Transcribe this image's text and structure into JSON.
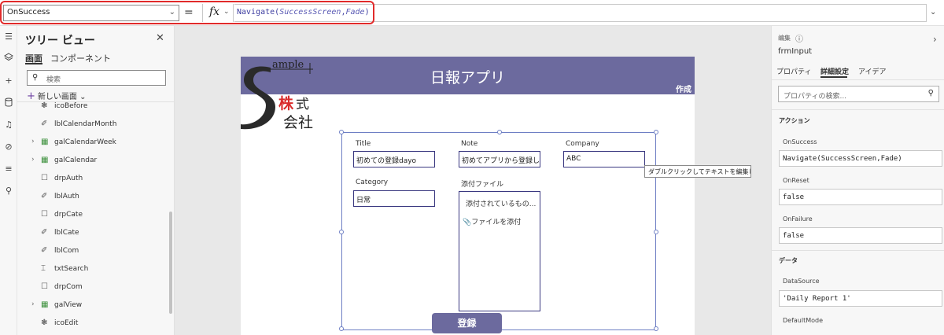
{
  "formula_bar": {
    "property": "OnSuccess",
    "equals": "=",
    "fx": "fx",
    "formula_func": "Navigate(",
    "formula_arg1": "SuccessScreen",
    "formula_sep": ",",
    "formula_arg2": "Fade",
    "formula_close": ")"
  },
  "tree": {
    "title": "ツリー ビュー",
    "tabs": [
      "画面",
      "コンポーネント"
    ],
    "search_placeholder": "検索",
    "new_screen": "新しい画面",
    "items": [
      {
        "label": "icoBefore",
        "icon": "icon-component-icon",
        "expandable": false
      },
      {
        "label": "lblCalendarMonth",
        "icon": "label-icon",
        "expandable": false
      },
      {
        "label": "galCalendarWeek",
        "icon": "gallery-icon",
        "expandable": true
      },
      {
        "label": "galCalendar",
        "icon": "gallery-icon",
        "expandable": true
      },
      {
        "label": "drpAuth",
        "icon": "dropdown-icon",
        "expandable": false
      },
      {
        "label": "lblAuth",
        "icon": "label-icon",
        "expandable": false
      },
      {
        "label": "drpCate",
        "icon": "dropdown-icon",
        "expandable": false
      },
      {
        "label": "lblCate",
        "icon": "label-icon",
        "expandable": false
      },
      {
        "label": "lblCom",
        "icon": "label-icon",
        "expandable": false
      },
      {
        "label": "txtSearch",
        "icon": "text-input-icon",
        "expandable": false
      },
      {
        "label": "drpCom",
        "icon": "dropdown-icon",
        "expandable": false
      },
      {
        "label": "galView",
        "icon": "gallery-icon",
        "expandable": true
      },
      {
        "label": "icoEdit",
        "icon": "icon-component-icon",
        "expandable": false
      }
    ]
  },
  "app": {
    "title": "日報アプリ",
    "create_label": "作成",
    "logo_text_top": "ample",
    "logo_text_mid1": "株",
    "logo_text_mid2": "式",
    "logo_text_bottom": "会社",
    "form": {
      "title_label": "Title",
      "title_value": "初めての登録dayo",
      "note_label": "Note",
      "note_value": "初めてアプリから登録します",
      "company_label": "Company",
      "company_value": "ABC",
      "category_label": "Category",
      "category_value": "日常",
      "attach_label": "添付ファイル",
      "attach_empty": "添付されているもの...",
      "attach_add": "ファイルを添付"
    },
    "tooltip": "ダブルクリックしてテキストを編集します",
    "submit": "登録"
  },
  "properties": {
    "edit_label": "编集",
    "control_name": "frmInput",
    "tabs": [
      "プロパティ",
      "詳細設定",
      "アイデア"
    ],
    "search_placeholder": "プロパティの検索...",
    "section_actions": "アクション",
    "on_success_label": "OnSuccess",
    "on_success_value": "Navigate(SuccessScreen,Fade)",
    "on_reset_label": "OnReset",
    "on_reset_value": "false",
    "on_failure_label": "OnFailure",
    "on_failure_value": "false",
    "section_data": "データ",
    "datasource_label": "DataSource",
    "datasource_value": "'Daily Report 1'",
    "defaultmode_label": "DefaultMode"
  },
  "colors": {
    "header": "#6c6a9e",
    "highlight": "#e12b2b",
    "selection": "#6e7fc4",
    "input_border": "#3a3880"
  }
}
